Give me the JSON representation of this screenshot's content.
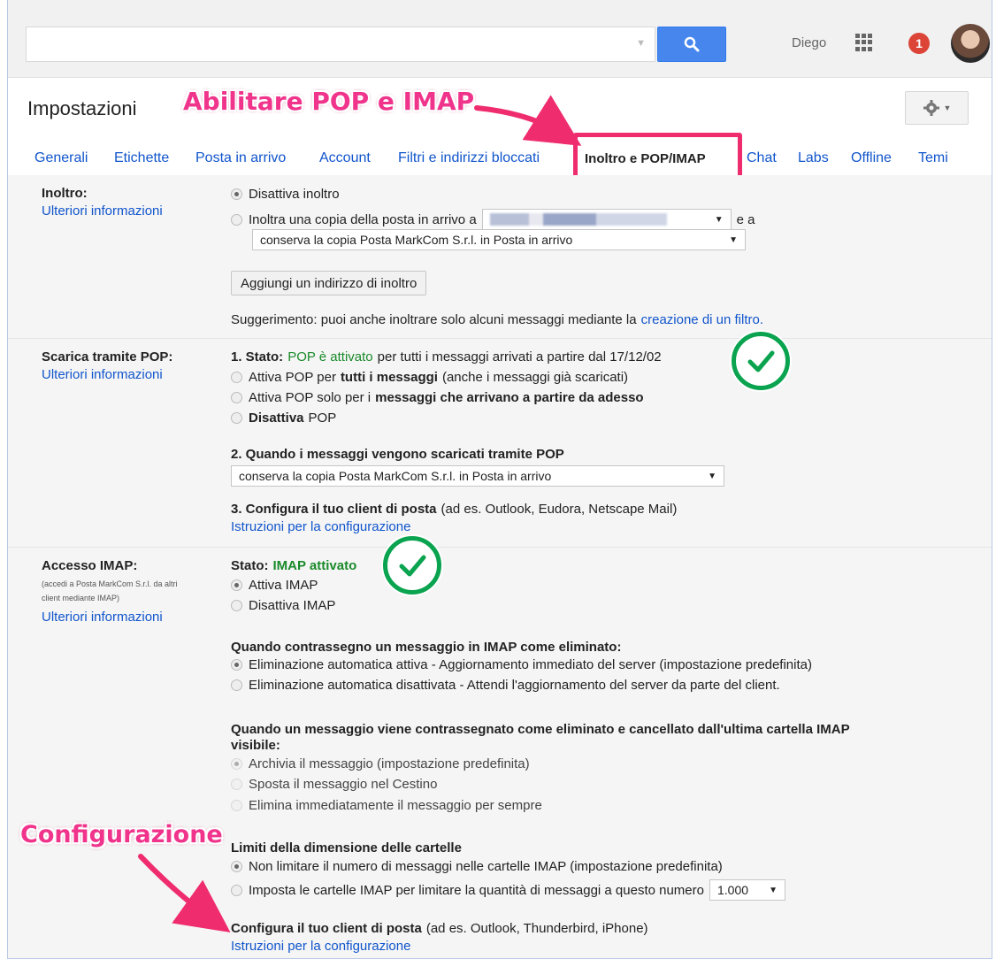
{
  "top_bar": {
    "user_name": "Diego",
    "notification_count": "1"
  },
  "header": {
    "page_title": "Impostazioni",
    "annotation_title": "Abilitare POP e IMAP",
    "annotation_config": "Configurazione"
  },
  "tabs": [
    {
      "label": "Generali"
    },
    {
      "label": "Etichette"
    },
    {
      "label": "Posta in arrivo"
    },
    {
      "label": "Account"
    },
    {
      "label": "Filtri e indirizzi bloccati"
    },
    {
      "label": "Inoltro e POP/IMAP",
      "active": true
    },
    {
      "label": "Chat"
    },
    {
      "label": "Labs"
    },
    {
      "label": "Offline"
    },
    {
      "label": "Temi"
    }
  ],
  "forwarding": {
    "label": "Inoltro:",
    "more_info": "Ulteriori informazioni",
    "option_disable": "Disattiva inoltro",
    "option_forward": "Inoltra una copia della posta in arrivo a",
    "and_text": "e a",
    "keep_copy_select": "conserva la copia Posta MarkCom S.r.l. in Posta in arrivo",
    "add_address_button": "Aggiungi un indirizzo di inoltro",
    "tip_text": "Suggerimento: puoi anche inoltrare solo alcuni messaggi mediante la",
    "tip_link": "creazione di un filtro."
  },
  "pop": {
    "label": "Scarica tramite POP:",
    "more_info": "Ulteriori informazioni",
    "status_prefix": "1. Stato:",
    "status_value": "POP è attivato",
    "status_suffix": "per tutti i messaggi arrivati a partire dal 17/12/02",
    "opt1_a": "Attiva POP per",
    "opt1_b": "tutti i messaggi",
    "opt1_c": "(anche i messaggi già scaricati)",
    "opt2_a": "Attiva POP solo per i",
    "opt2_b": "messaggi che arrivano a partire da adesso",
    "opt3_a": "Disattiva",
    "opt3_b": "POP",
    "q2_title": "2. Quando i messaggi vengono scaricati tramite POP",
    "q2_select": "conserva la copia Posta MarkCom S.r.l. in Posta in arrivo",
    "q3_title": "3. Configura il tuo client di posta",
    "q3_suffix": "(ad es. Outlook, Eudora, Netscape Mail)",
    "q3_link": "Istruzioni per la configurazione"
  },
  "imap": {
    "label": "Accesso IMAP:",
    "sub_line1": "(accedi a Posta MarkCom S.r.l. da altri",
    "sub_line2": "client mediante IMAP)",
    "more_info": "Ulteriori informazioni",
    "status_prefix": "Stato:",
    "status_value": "IMAP attivato",
    "opt_enable": "Attiva IMAP",
    "opt_disable": "Disattiva IMAP",
    "deleted_title": "Quando contrassegno un messaggio in IMAP come eliminato:",
    "deleted_opt1": "Eliminazione automatica attiva - Aggiornamento immediato del server (impostazione predefinita)",
    "deleted_opt2": "Eliminazione automatica disattivata - Attendi l'aggiornamento del server da parte del client.",
    "expunge_title_1": "Quando un messaggio viene contrassegnato come eliminato e cancellato dall'ultima cartella IMAP",
    "expunge_title_2": "visibile:",
    "expunge_opt1": "Archivia il messaggio (impostazione predefinita)",
    "expunge_opt2": "Sposta il messaggio nel Cestino",
    "expunge_opt3": "Elimina immediatamente il messaggio per sempre",
    "limits_title": "Limiti della dimensione delle cartelle",
    "limits_opt1": "Non limitare il numero di messaggi nelle cartelle IMAP (impostazione predefinita)",
    "limits_opt2": "Imposta le cartelle IMAP per limitare la quantità di messaggi a questo numero",
    "limits_select": "1.000",
    "config_title": "Configura il tuo client di posta",
    "config_suffix": "(ad es. Outlook, Thunderbird, iPhone)",
    "config_link": "Istruzioni per la configurazione"
  },
  "colors": {
    "link": "#1155cc",
    "status_green": "#1a8a2a",
    "annotation_pink": "#f0348c",
    "check_green": "#0aa34f"
  }
}
